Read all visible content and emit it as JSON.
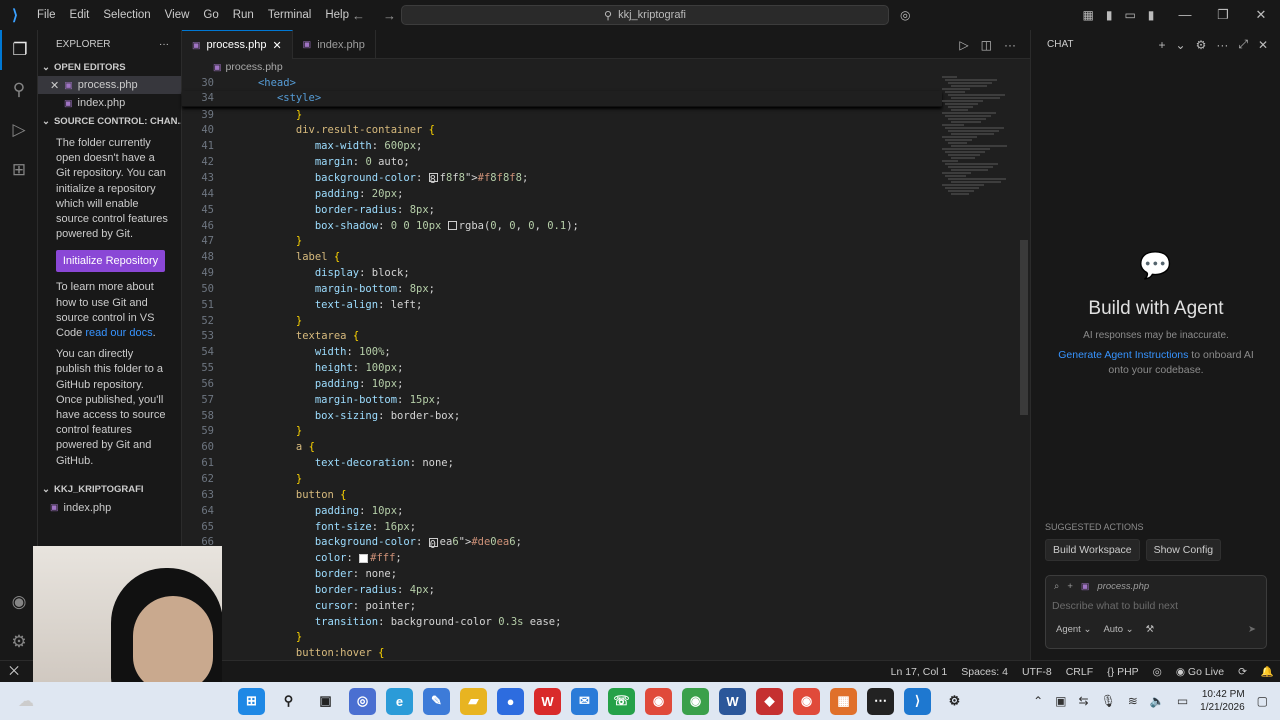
{
  "titlebar": {
    "menu": [
      "File",
      "Edit",
      "Selection",
      "View",
      "Go",
      "Run",
      "Terminal",
      "Help"
    ],
    "search_text": "kkj_kriptografi"
  },
  "explorer": {
    "title": "EXPLORER",
    "open_editors_label": "OPEN EDITORS",
    "open_editors": [
      "process.php",
      "index.php"
    ],
    "scm_label": "SOURCE CONTROL: CHAN...",
    "scm_text1": "The folder currently open doesn't have a Git repository. You can initialize a repository which will enable source control features powered by Git.",
    "init_button": "Initialize Repository",
    "scm_text2_pre": "To learn more about how to use Git and source control in VS Code ",
    "scm_text2_link": "read our docs",
    "scm_text2_post": ".",
    "scm_text3": "You can directly publish this folder to a GitHub repository. Once published, you'll have access to source control features powered by Git and GitHub.",
    "project_label": "KKJ_KRIPTOGRAFI",
    "project_files": [
      "index.php"
    ]
  },
  "editor": {
    "tabs": [
      "process.php",
      "index.php"
    ],
    "breadcrumb": "process.php",
    "sticky": [
      {
        "n": "30",
        "t": "<head>"
      },
      {
        "n": "34",
        "t": "<style>"
      }
    ],
    "lines": [
      {
        "n": "39",
        "t": "}"
      },
      {
        "n": "40",
        "t": "div.result-container {"
      },
      {
        "n": "41",
        "t": "max-width: 600px;"
      },
      {
        "n": "42",
        "t": "margin: 0 auto;"
      },
      {
        "n": "43",
        "t": "background-color: #f8f8f8;"
      },
      {
        "n": "44",
        "t": "padding: 20px;"
      },
      {
        "n": "45",
        "t": "border-radius: 8px;"
      },
      {
        "n": "46",
        "t": "box-shadow: 0 0 10px rgba(0, 0, 0, 0.1);"
      },
      {
        "n": "47",
        "t": "}"
      },
      {
        "n": "48",
        "t": "label {"
      },
      {
        "n": "49",
        "t": "display: block;"
      },
      {
        "n": "50",
        "t": "margin-bottom: 8px;"
      },
      {
        "n": "51",
        "t": "text-align: left;"
      },
      {
        "n": "52",
        "t": "}"
      },
      {
        "n": "53",
        "t": "textarea {"
      },
      {
        "n": "54",
        "t": "width: 100%;"
      },
      {
        "n": "55",
        "t": "height: 100px;"
      },
      {
        "n": "56",
        "t": "padding: 10px;"
      },
      {
        "n": "57",
        "t": "margin-bottom: 15px;"
      },
      {
        "n": "58",
        "t": "box-sizing: border-box;"
      },
      {
        "n": "59",
        "t": "}"
      },
      {
        "n": "60",
        "t": "a {"
      },
      {
        "n": "61",
        "t": "text-decoration: none;"
      },
      {
        "n": "62",
        "t": "}"
      },
      {
        "n": "63",
        "t": "button {"
      },
      {
        "n": "64",
        "t": "padding: 10px;"
      },
      {
        "n": "65",
        "t": "font-size: 16px;"
      },
      {
        "n": "66",
        "t": "background-color: #de0ea6;"
      },
      {
        "n": "67",
        "t": "color: #fff;"
      },
      {
        "n": "68",
        "t": "border: none;"
      },
      {
        "n": "69",
        "t": "border-radius: 4px;"
      },
      {
        "n": "70",
        "t": "cursor: pointer;"
      },
      {
        "n": "71",
        "t": "transition: background-color 0.3s ease;"
      },
      {
        "n": "72",
        "t": "}"
      },
      {
        "n": "73",
        "t": "button:hover {"
      }
    ]
  },
  "chat": {
    "title": "CHAT",
    "heading": "Build with Agent",
    "subtitle": "AI responses may be inaccurate.",
    "gen_link": "Generate Agent Instructions",
    "gen_rest": " to onboard AI onto your codebase.",
    "suggested_label": "SUGGESTED ACTIONS",
    "suggestions": [
      "Build Workspace",
      "Show Config"
    ],
    "context_file": "process.php",
    "input_placeholder": "Describe what to build next",
    "mode": "Agent",
    "model": "Auto"
  },
  "status": {
    "position": "Ln 17, Col 1",
    "spaces": "Spaces: 4",
    "encoding": "UTF-8",
    "eol": "CRLF",
    "language": "PHP",
    "golive": "Go Live"
  },
  "taskbar": {
    "time": "10:42 PM",
    "date": "1/21/2026"
  },
  "colors": {
    "accent": "#0078d4",
    "button": "#8a47d6",
    "swatch_bg": "#f8f8f8",
    "swatch_button": "#de0ea6"
  }
}
